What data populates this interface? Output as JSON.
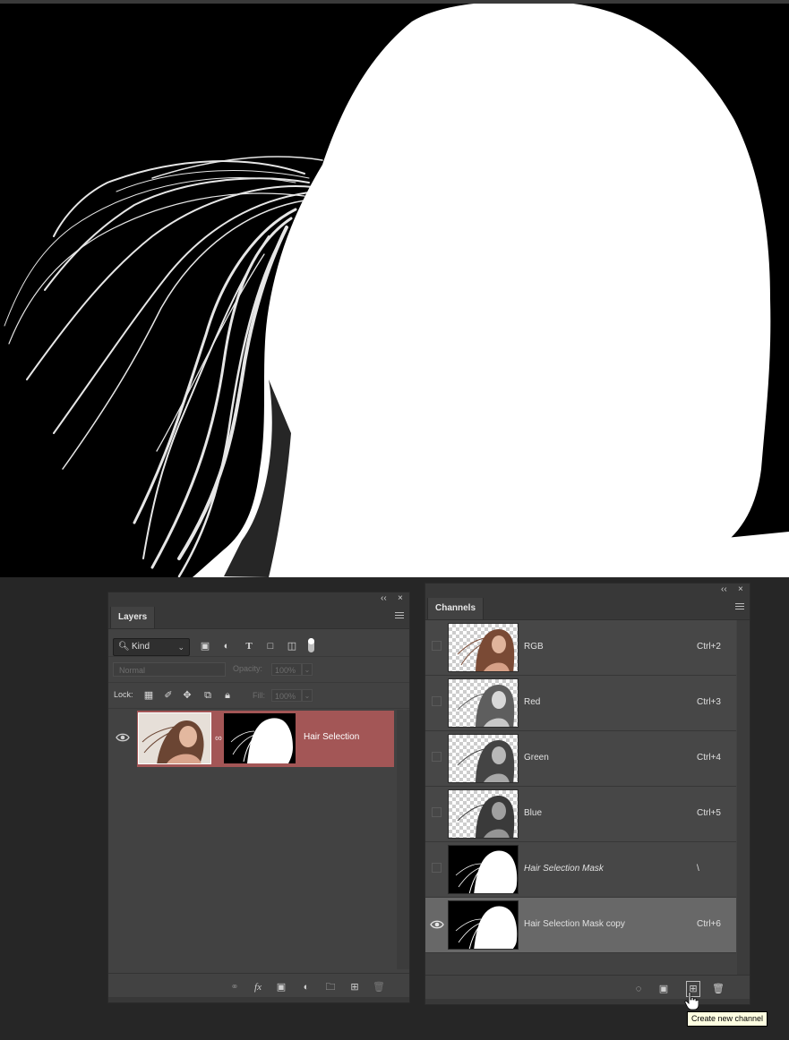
{
  "canvas": {
    "description_colors": {
      "background": "#000000",
      "mask": "#ffffff"
    }
  },
  "layers_panel": {
    "tab_label": "Layers",
    "collapse_glyph": "‹‹",
    "close_glyph": "×",
    "filter": {
      "kind_label": "Kind",
      "kind_icon": "search-icon",
      "filter_icons": [
        "image-filter-icon",
        "adjustment-filter-icon",
        "type-filter-icon",
        "shape-filter-icon",
        "smart-object-filter-icon"
      ]
    },
    "blend_mode": "Normal",
    "opacity_label": "Opacity:",
    "opacity_value": "100%",
    "lock_label": "Lock:",
    "fill_label": "Fill:",
    "fill_value": "100%",
    "layers": [
      {
        "name": "Hair Selection",
        "visible": true,
        "selected": true,
        "has_mask": true
      }
    ],
    "footer_icons": [
      "link-layers-icon",
      "fx-icon",
      "add-mask-icon",
      "adjustment-layer-icon",
      "new-group-icon",
      "new-layer-icon",
      "delete-layer-icon"
    ],
    "fx_label": "fx",
    "colors": {
      "selected_row": "#a35656"
    }
  },
  "channels_panel": {
    "tab_label": "Channels",
    "collapse_glyph": "‹‹",
    "close_glyph": "×",
    "channels": [
      {
        "name": "RGB",
        "shortcut": "Ctrl+2",
        "visible": false,
        "selected": false,
        "thumb": "color"
      },
      {
        "name": "Red",
        "shortcut": "Ctrl+3",
        "visible": false,
        "selected": false,
        "thumb": "gray"
      },
      {
        "name": "Green",
        "shortcut": "Ctrl+4",
        "visible": false,
        "selected": false,
        "thumb": "gray"
      },
      {
        "name": "Blue",
        "shortcut": "Ctrl+5",
        "visible": false,
        "selected": false,
        "thumb": "gray"
      },
      {
        "name": "Hair Selection Mask",
        "shortcut": "\\",
        "visible": false,
        "selected": false,
        "thumb": "mask",
        "italic": true
      },
      {
        "name": "Hair Selection Mask copy",
        "shortcut": "Ctrl+6",
        "visible": true,
        "selected": true,
        "thumb": "mask"
      }
    ],
    "footer_icons": [
      "load-selection-icon",
      "save-selection-icon",
      "new-channel-icon",
      "delete-channel-icon"
    ],
    "tooltip": "Create new channel"
  }
}
